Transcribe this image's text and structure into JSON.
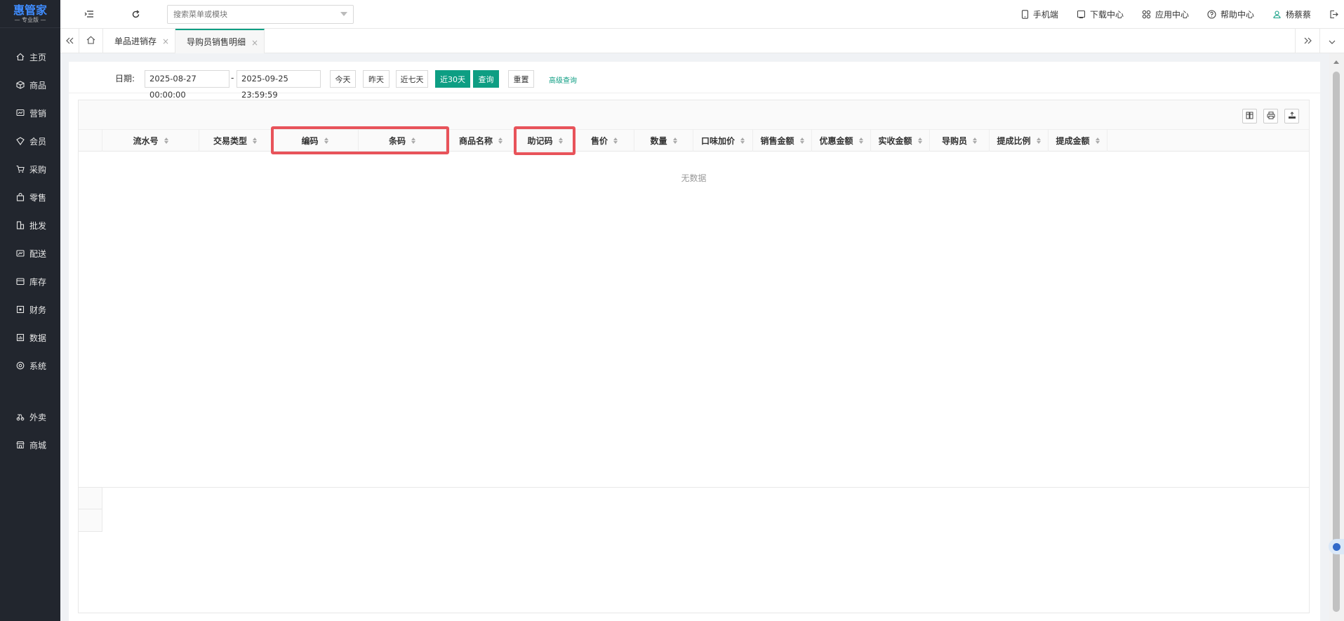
{
  "brand": {
    "name": "惠管家",
    "edition": "— 专业版 —"
  },
  "sidebar": {
    "items": [
      {
        "label": "主页",
        "icon": "home-icon"
      },
      {
        "label": "商品",
        "icon": "cube-icon"
      },
      {
        "label": "营销",
        "icon": "marketing-icon"
      },
      {
        "label": "会员",
        "icon": "member-icon"
      },
      {
        "label": "采购",
        "icon": "cart-icon"
      },
      {
        "label": "零售",
        "icon": "bag-icon"
      },
      {
        "label": "批发",
        "icon": "building-icon"
      },
      {
        "label": "配送",
        "icon": "delivery-icon"
      },
      {
        "label": "库存",
        "icon": "box-icon"
      },
      {
        "label": "财务",
        "icon": "finance-icon"
      },
      {
        "label": "数据",
        "icon": "chart-icon"
      },
      {
        "label": "系统",
        "icon": "settings-icon"
      }
    ],
    "extra_items": [
      {
        "label": "外卖",
        "icon": "takeaway-icon"
      },
      {
        "label": "商城",
        "icon": "shop-icon"
      }
    ]
  },
  "topbar": {
    "search_placeholder": "搜索菜单或模块",
    "mobile": "手机端",
    "download": "下载中心",
    "apps": "应用中心",
    "help": "帮助中心",
    "user": "杨蔡蔡"
  },
  "tabs": {
    "items": [
      {
        "label": "单品进销存",
        "active": false
      },
      {
        "label": "导购员销售明细",
        "active": true
      }
    ],
    "close": "×"
  },
  "filter": {
    "date_label": "日期:",
    "start": "2025-08-27 00:00:00",
    "separator": "-",
    "end": "2025-09-25 23:59:59",
    "today": "今天",
    "yesterday": "昨天",
    "last7": "近七天",
    "last30": "近30天",
    "query": "查询",
    "reset": "重置",
    "advanced": "高级查询"
  },
  "table": {
    "columns": [
      "流水号",
      "交易类型",
      "编码",
      "条码",
      "商品名称",
      "助记码",
      "售价",
      "数量",
      "口味加价",
      "销售金额",
      "优惠金额",
      "实收金额",
      "导购员",
      "提成比例",
      "提成金额"
    ],
    "empty": "无数据"
  },
  "colors": {
    "accent": "#0e9e83",
    "highlight": "#e8535a",
    "sidebar": "#22262e"
  }
}
